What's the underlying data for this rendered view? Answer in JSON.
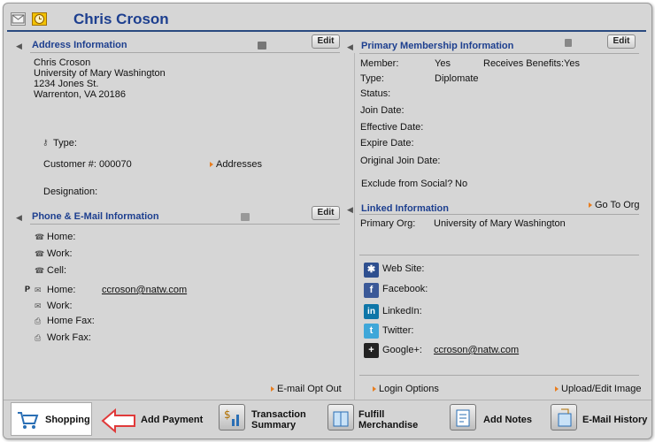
{
  "header": {
    "name": "Chris Croson"
  },
  "address": {
    "title": "Address Information",
    "edit_label": "Edit",
    "lines": [
      "Chris Croson",
      "University of Mary Washington",
      "1234 Jones St.",
      "Warrenton, VA 20186"
    ],
    "type_label": "Type:",
    "customer_label": "Customer #:",
    "customer_value": "000070",
    "addresses_link": "Addresses",
    "designation_label": "Designation:"
  },
  "membership": {
    "title": "Primary Membership Information",
    "edit_label": "Edit",
    "member_label": "Member:",
    "member_value": "Yes",
    "benefits_label": "Receives Benefits:",
    "benefits_value": "Yes",
    "type_label": "Type:",
    "type_value": "Diplomate",
    "status_label": "Status:",
    "join_label": "Join Date:",
    "effective_label": "Effective Date:",
    "expire_label": "Expire Date:",
    "original_label": "Original Join Date:",
    "exclude_label": "Exclude from Social?",
    "exclude_value": "No"
  },
  "phone": {
    "title": "Phone & E-Mail Information",
    "edit_label": "Edit",
    "home_label": "Home:",
    "work_label": "Work:",
    "cell_label": "Cell:",
    "primary_marker": "P",
    "email_home_label": "Home:",
    "email_home_value": "ccroson@natw.com",
    "email_work_label": "Work:",
    "home_fax_label": "Home Fax:",
    "work_fax_label": "Work Fax:",
    "optout_link": "E-mail Opt Out"
  },
  "linked": {
    "title": "Linked Information",
    "goto_link": "Go To Org",
    "primary_org_label": "Primary Org:",
    "primary_org_value": "University of Mary Washington",
    "website_label": "Web Site:",
    "facebook_label": "Facebook:",
    "linkedin_label": "LinkedIn:",
    "twitter_label": "Twitter:",
    "googleplus_label": "Google+:",
    "googleplus_value": "ccroson@natw.com",
    "login_link": "Login Options",
    "upload_link": "Upload/Edit Image"
  },
  "footer": {
    "shopping": "Shopping",
    "add_payment": "Add Payment",
    "transaction_1": "Transaction",
    "transaction_2": "Summary",
    "fulfill_1": "Fulfill",
    "fulfill_2": "Merchandise",
    "add_notes": "Add Notes",
    "email_history": "E-Mail History"
  },
  "colors": {
    "title_blue": "#1d3f8f",
    "link_arrow": "#e87d1e",
    "panel_bg": "#d6d6d6"
  }
}
